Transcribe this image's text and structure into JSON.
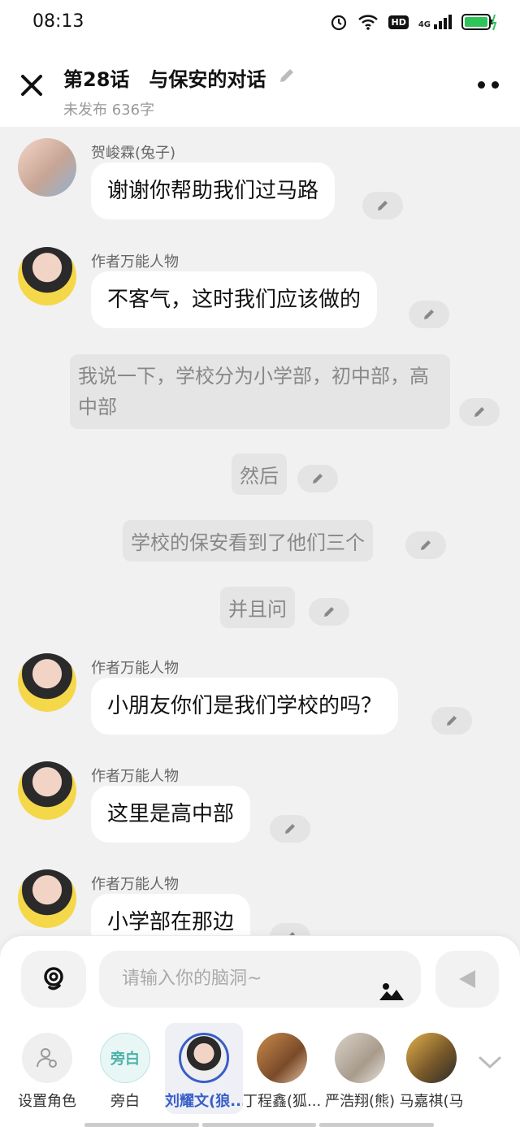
{
  "status": {
    "time": "08:13",
    "hd": "HD",
    "net": "4G"
  },
  "header": {
    "title": "第28话　与保安的对话",
    "subtitle": "未发布 636字"
  },
  "messages": [
    {
      "name": "贺峻霖(兔子)",
      "text": "谢谢你帮助我们过马路"
    },
    {
      "name": "作者万能人物",
      "text": "不客气，这时我们应该做的"
    },
    {
      "narration": "我说一下，学校分为小学部，初中部，高中部"
    },
    {
      "narration": "然后"
    },
    {
      "narration": "学校的保安看到了他们三个"
    },
    {
      "narration": "并且问"
    },
    {
      "name": "作者万能人物",
      "text": "小朋友你们是我们学校的吗？"
    },
    {
      "name": "作者万能人物",
      "text": "这里是高中部"
    },
    {
      "name": "作者万能人物",
      "text": "小学部在那边"
    }
  ],
  "input": {
    "placeholder": "请输入你的脑洞~"
  },
  "roles": [
    {
      "label": "设置角色"
    },
    {
      "label": "旁白",
      "badge": "旁白"
    },
    {
      "label": "刘耀文(狼..."
    },
    {
      "label": "丁程鑫(狐..."
    },
    {
      "label": "严浩翔(熊)"
    },
    {
      "label": "马嘉祺(马"
    }
  ],
  "colors": {
    "accent": "#3a5ec8",
    "bubble": "#ffffff",
    "background": "#f1f1f1"
  }
}
